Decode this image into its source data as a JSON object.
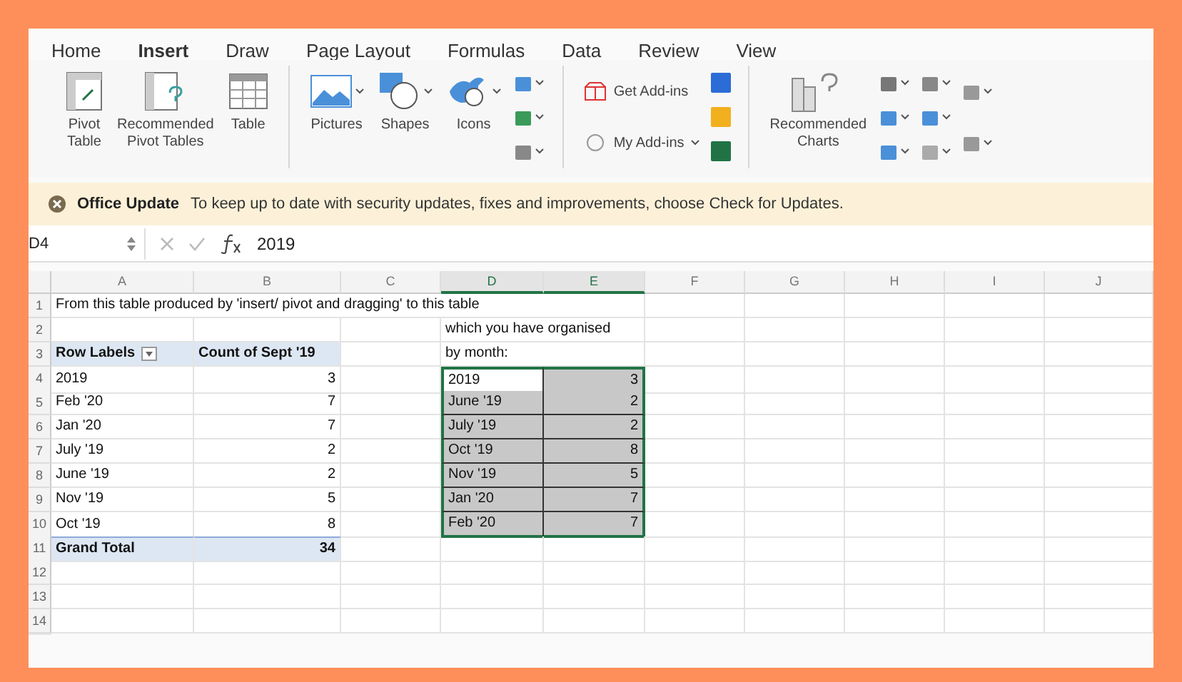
{
  "tabs": [
    {
      "label": "Home",
      "selected": false
    },
    {
      "label": "Insert",
      "selected": true
    },
    {
      "label": "Draw",
      "selected": false
    },
    {
      "label": "Page Layout",
      "selected": false
    },
    {
      "label": "Formulas",
      "selected": false
    },
    {
      "label": "Data",
      "selected": false
    },
    {
      "label": "Review",
      "selected": false
    },
    {
      "label": "View",
      "selected": false
    }
  ],
  "ribbon": {
    "groups": [
      {
        "items": [
          {
            "kind": "pivot",
            "label": "Pivot\nTable"
          },
          {
            "kind": "recommended-pivot",
            "label": "Recommended\nPivot Tables"
          },
          {
            "kind": "table",
            "label": "Table"
          }
        ]
      },
      {
        "items": [
          {
            "kind": "pictures",
            "label": "Pictures"
          },
          {
            "kind": "shapes",
            "label": "Shapes"
          },
          {
            "kind": "icons",
            "label": "Icons"
          }
        ]
      },
      {
        "items": [
          {
            "kind": "get-addins",
            "label": "Get Add-ins"
          },
          {
            "kind": "my-addins",
            "label": "My Add-ins"
          }
        ]
      },
      {
        "items": [
          {
            "kind": "recommended-charts",
            "label": "Recommended\nCharts"
          }
        ]
      }
    ]
  },
  "notice": {
    "title": "Office Update",
    "message": "To keep up to date with security updates, fixes and improvements, choose Check for Updates."
  },
  "formula_bar": {
    "cell_ref": "D4",
    "value": "2019"
  },
  "sheet": {
    "columns": [
      {
        "label": "A",
        "selected": false
      },
      {
        "label": "B",
        "selected": false
      },
      {
        "label": "C",
        "selected": false
      },
      {
        "label": "D",
        "selected": true
      },
      {
        "label": "E",
        "selected": true
      },
      {
        "label": "F",
        "selected": false
      },
      {
        "label": "G",
        "selected": false
      },
      {
        "label": "H",
        "selected": false
      },
      {
        "label": "I",
        "selected": false
      },
      {
        "label": "J",
        "selected": false
      }
    ],
    "rows": [
      {
        "number": "1",
        "cells": {
          "A": {
            "text": "From this table produced by 'insert/ pivot and dragging' to this table",
            "kind": "text",
            "selected": false,
            "active": false
          }
        }
      },
      {
        "number": "2",
        "cells": {
          "D": {
            "text": "which you have organised",
            "kind": "text",
            "selected": false,
            "active": false
          }
        }
      },
      {
        "number": "3",
        "cells": {
          "A": {
            "text": "Row Labels",
            "kind": "filter-header",
            "selected": false,
            "active": false
          },
          "B": {
            "text": "Count of Sept '19",
            "kind": "header",
            "selected": false,
            "active": false
          },
          "D": {
            "text": "by month:",
            "kind": "text",
            "selected": false,
            "active": false
          }
        }
      },
      {
        "number": "4",
        "cells": {
          "A": {
            "text": "2019",
            "kind": "text",
            "selected": false,
            "active": false
          },
          "B": {
            "text": "3",
            "kind": "number",
            "selected": false,
            "active": false
          },
          "D": {
            "text": "2019",
            "kind": "list-text",
            "selected": true,
            "active": true
          },
          "E": {
            "text": "3",
            "kind": "list-number",
            "selected": true,
            "active": false
          }
        }
      },
      {
        "number": "5",
        "cells": {
          "A": {
            "text": "Feb '20",
            "kind": "text",
            "selected": false,
            "active": false
          },
          "B": {
            "text": "7",
            "kind": "number",
            "selected": false,
            "active": false
          },
          "D": {
            "text": "June '19",
            "kind": "list-text",
            "selected": true,
            "active": false
          },
          "E": {
            "text": "2",
            "kind": "list-number",
            "selected": true,
            "active": false
          }
        }
      },
      {
        "number": "6",
        "cells": {
          "A": {
            "text": "Jan '20",
            "kind": "text",
            "selected": false,
            "active": false
          },
          "B": {
            "text": "7",
            "kind": "number",
            "selected": false,
            "active": false
          },
          "D": {
            "text": "July '19",
            "kind": "list-text",
            "selected": true,
            "active": false
          },
          "E": {
            "text": "2",
            "kind": "list-number",
            "selected": true,
            "active": false
          }
        }
      },
      {
        "number": "7",
        "cells": {
          "A": {
            "text": "July '19",
            "kind": "text",
            "selected": false,
            "active": false
          },
          "B": {
            "text": "2",
            "kind": "number",
            "selected": false,
            "active": false
          },
          "D": {
            "text": "Oct '19",
            "kind": "list-text",
            "selected": true,
            "active": false
          },
          "E": {
            "text": "8",
            "kind": "list-number",
            "selected": true,
            "active": false
          }
        }
      },
      {
        "number": "8",
        "cells": {
          "A": {
            "text": "June '19",
            "kind": "text",
            "selected": false,
            "active": false
          },
          "B": {
            "text": "2",
            "kind": "number",
            "selected": false,
            "active": false
          },
          "D": {
            "text": "Nov '19",
            "kind": "list-text",
            "selected": true,
            "active": false
          },
          "E": {
            "text": "5",
            "kind": "list-number",
            "selected": true,
            "active": false
          }
        }
      },
      {
        "number": "9",
        "cells": {
          "A": {
            "text": "Nov '19",
            "kind": "text",
            "selected": false,
            "active": false
          },
          "B": {
            "text": "5",
            "kind": "number",
            "selected": false,
            "active": false
          },
          "D": {
            "text": "Jan '20",
            "kind": "list-text",
            "selected": true,
            "active": false
          },
          "E": {
            "text": "7",
            "kind": "list-number",
            "selected": true,
            "active": false
          }
        }
      },
      {
        "number": "10",
        "cells": {
          "A": {
            "text": "Oct '19",
            "kind": "text",
            "selected": false,
            "active": false
          },
          "B": {
            "text": "8",
            "kind": "number",
            "selected": false,
            "active": false
          },
          "D": {
            "text": "Feb '20",
            "kind": "list-text",
            "selected": true,
            "active": false
          },
          "E": {
            "text": "7",
            "kind": "list-number",
            "selected": true,
            "active": false
          }
        }
      },
      {
        "number": "11",
        "cells": {
          "A": {
            "text": "Grand Total",
            "kind": "total",
            "selected": false,
            "active": false
          },
          "B": {
            "text": "34",
            "kind": "total-number",
            "selected": false,
            "active": false
          }
        }
      },
      {
        "number": "12"
      },
      {
        "number": "13"
      },
      {
        "number": "14"
      }
    ]
  }
}
